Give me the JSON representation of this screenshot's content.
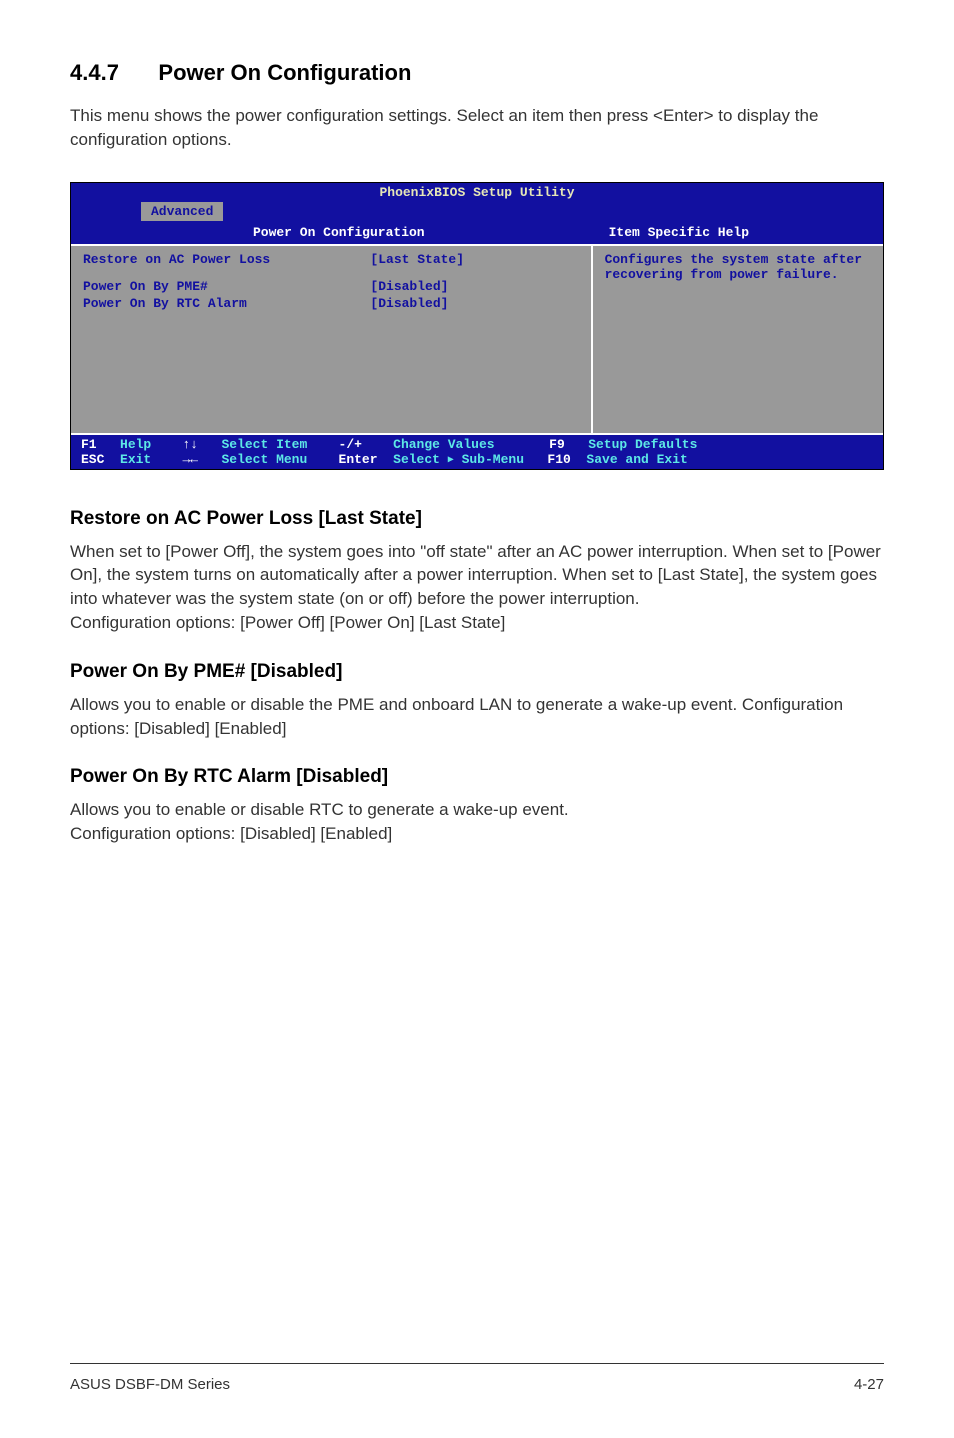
{
  "section": {
    "number": "4.4.7",
    "title": "Power On Configuration"
  },
  "intro": "This menu shows the power configuration settings. Select an item then press <Enter> to display the configuration options.",
  "bios": {
    "title": "PhoenixBIOS Setup Utility",
    "tab": "Advanced",
    "pane_title": "Power On Configuration",
    "help_title": "Item Specific Help",
    "rows": [
      {
        "k": "Restore on AC Power Loss",
        "v": "[Last State]"
      },
      {
        "k": "Power On By PME#",
        "v": "[Disabled]"
      },
      {
        "k": "Power On By RTC Alarm",
        "v": "[Disabled]"
      }
    ],
    "help_text": "Configures the system state after recovering from power failure.",
    "footer": {
      "F1": "F1",
      "Help": "Help",
      "arrows_ud": "↑↓",
      "SelectItem": "Select Item",
      "minusplus": "-/+",
      "ChangeValues": "Change Values",
      "F9": "F9",
      "SetupDefaults": "Setup Defaults",
      "ESC": "ESC",
      "Exit": "Exit",
      "arrows_lr": "→←",
      "SelectMenu": "Select Menu",
      "Enter": "Enter",
      "SelectSub": "Select    Sub-Menu",
      "F10": "F10",
      "SaveExit": "Save and Exit"
    }
  },
  "sub1": {
    "title": "Restore on AC Power Loss [Last State]",
    "body": "When set to [Power Off], the system goes into \"off state\" after an AC power interruption. When set to [Power On], the system turns on automatically after a power interruption. When set to [Last State], the system goes into whatever was the system state (on or off) before the power interruption.\nConfiguration options: [Power Off] [Power On] [Last State]"
  },
  "sub2": {
    "title": "Power On By PME# [Disabled]",
    "body": "Allows you to enable or disable the PME and onboard LAN to generate a wake-up event. Configuration options: [Disabled] [Enabled]"
  },
  "sub3": {
    "title": "Power On By RTC Alarm [Disabled]",
    "body": "Allows you to enable or disable RTC to generate a wake-up event.\nConfiguration options: [Disabled] [Enabled]"
  },
  "footer": {
    "left": "ASUS DSBF-DM Series",
    "right": "4-27"
  }
}
